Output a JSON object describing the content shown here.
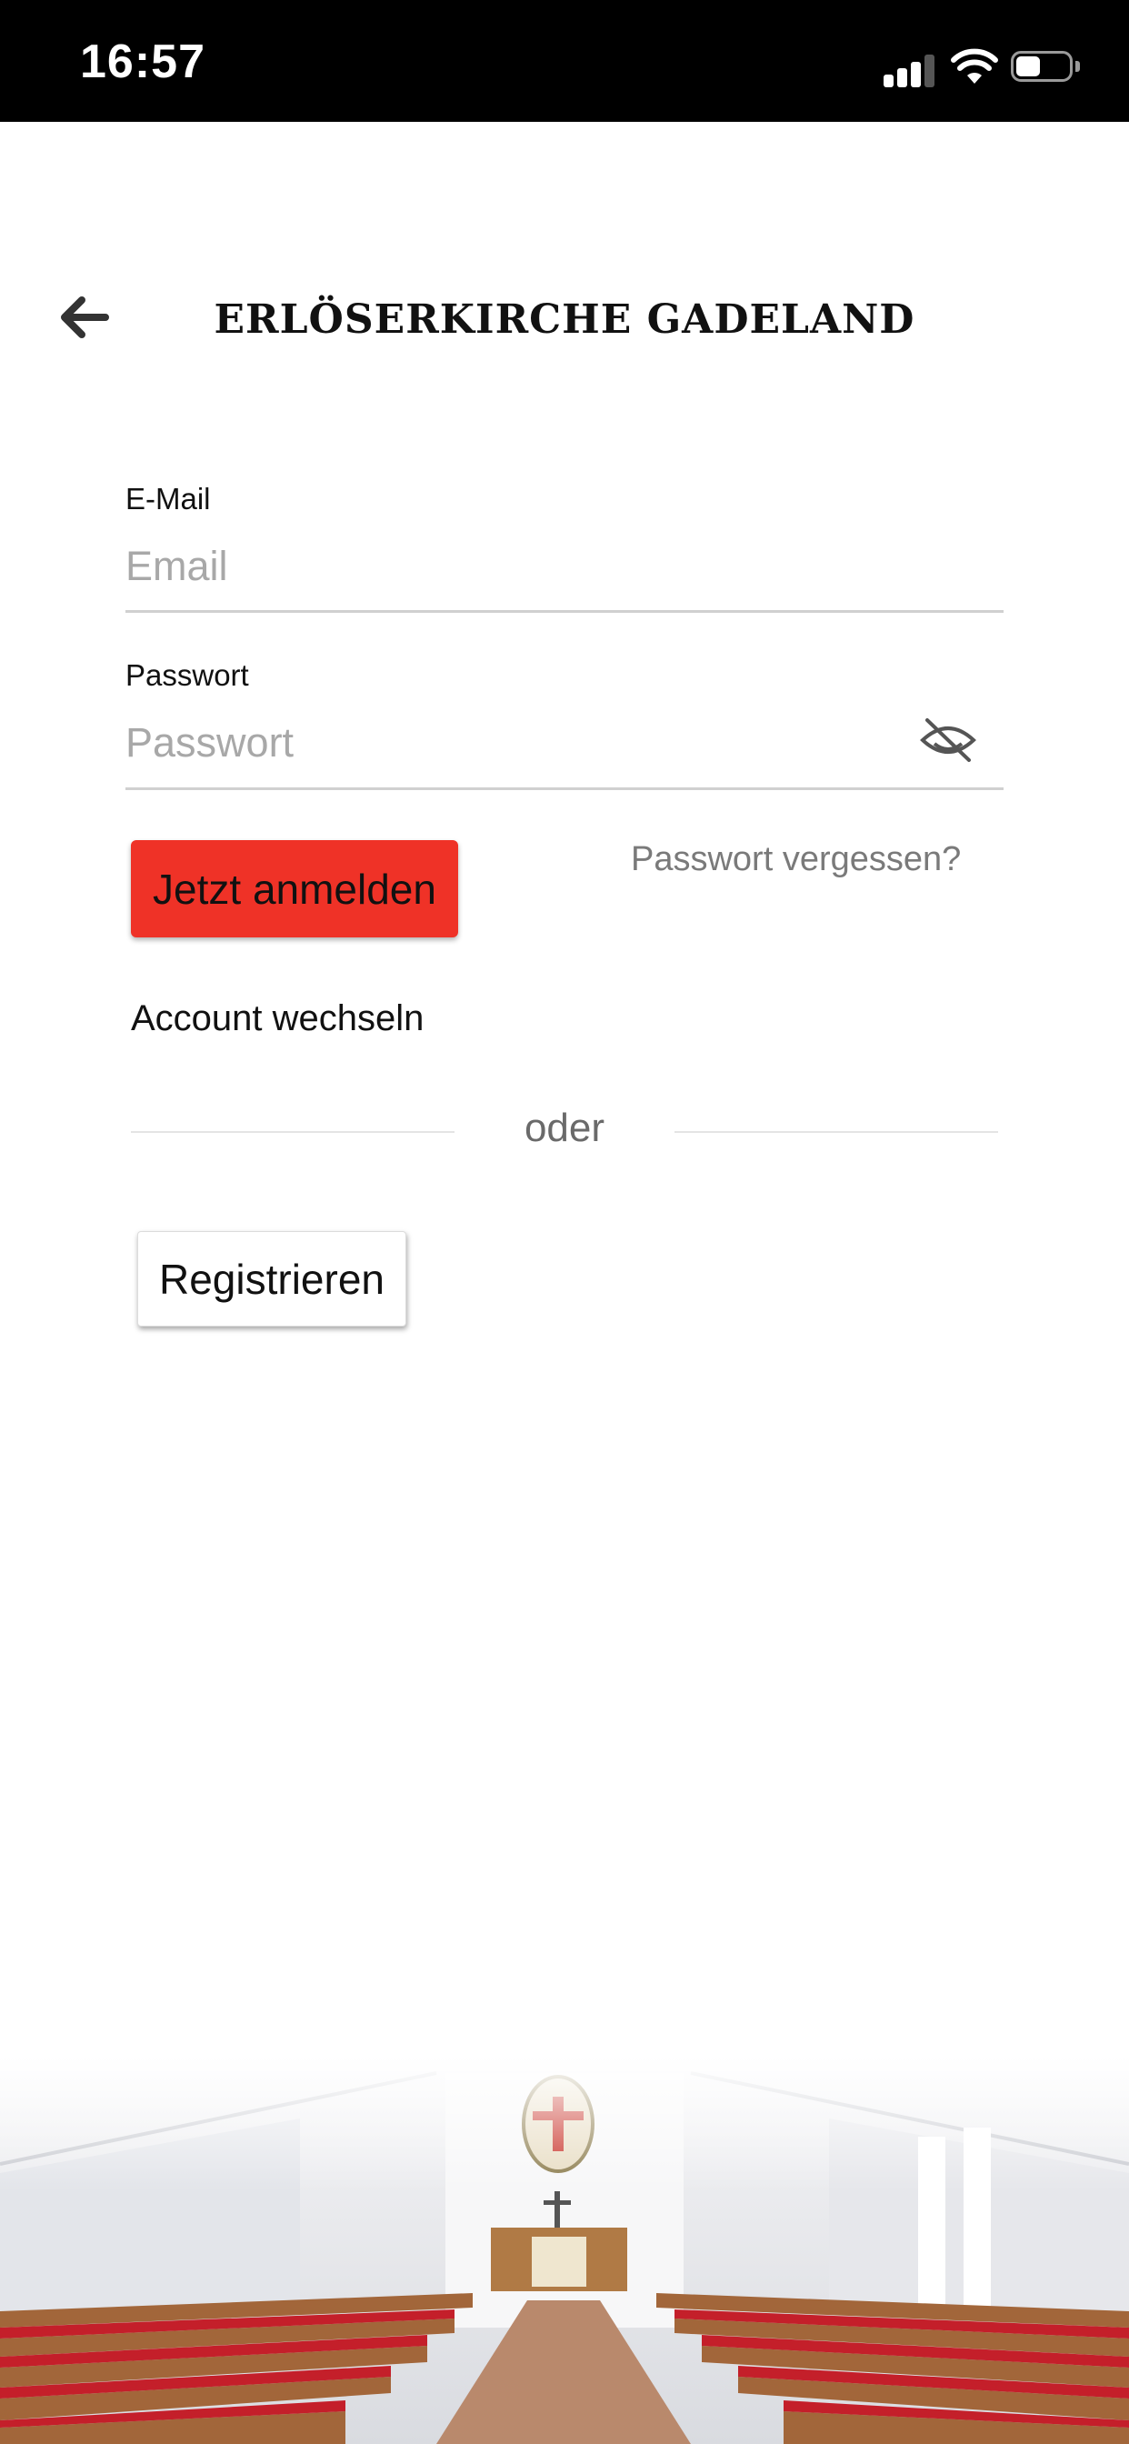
{
  "status_bar": {
    "time": "16:57",
    "icons": [
      "cellular-signal-icon",
      "wifi-icon",
      "battery-icon"
    ]
  },
  "header": {
    "title": "ERLÖSERKIRCHE GADELAND",
    "back_icon": "arrow-left-icon"
  },
  "form": {
    "email_label": "E-Mail",
    "email_placeholder": "Email",
    "email_value": "",
    "password_label": "Passwort",
    "password_placeholder": "Passwort",
    "password_value": "",
    "password_toggle_icon": "eye-slash-icon",
    "login_button": "Jetzt anmelden",
    "forgot_password": "Passwort vergessen?",
    "switch_account": "Account wechseln",
    "divider": "oder",
    "register_button": "Registrieren"
  },
  "footer": {
    "image": "church-interior-photo"
  },
  "colors": {
    "accent": "#ef3227",
    "status_bar_bg": "#000000",
    "placeholder": "#a8a8a8",
    "link": "#7a7a7a"
  }
}
